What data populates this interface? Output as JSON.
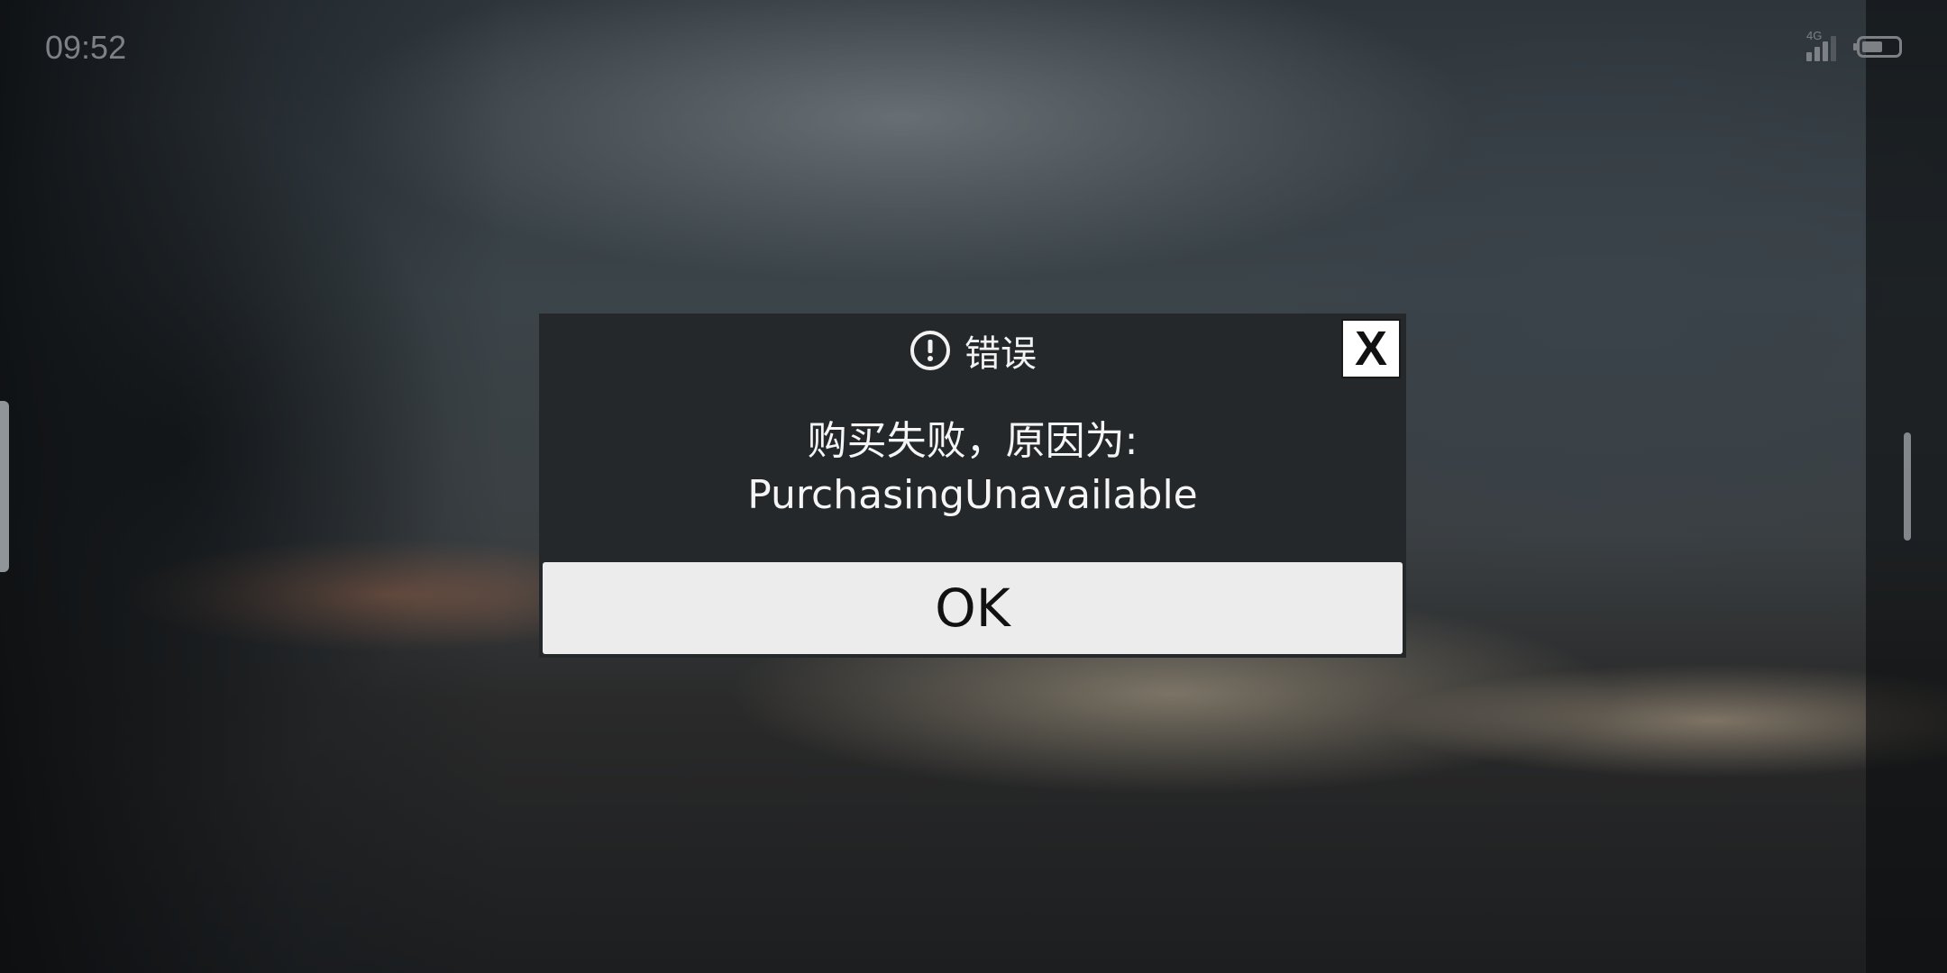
{
  "status_bar": {
    "time": "09:52",
    "network": "4G",
    "signal_level": 3,
    "battery_level": 0.58,
    "icons": [
      "signal-icon",
      "battery-icon"
    ]
  },
  "dialog": {
    "icon": "alert-icon",
    "title": "错误",
    "message_line1": "购买失败，原因为:",
    "message_line2": "PurchasingUnavailable",
    "close_label": "X",
    "ok_label": "OK"
  },
  "colors": {
    "dialog_background": "#24282b",
    "ok_button_background": "#ececec",
    "text_light": "#f2f2f2"
  }
}
